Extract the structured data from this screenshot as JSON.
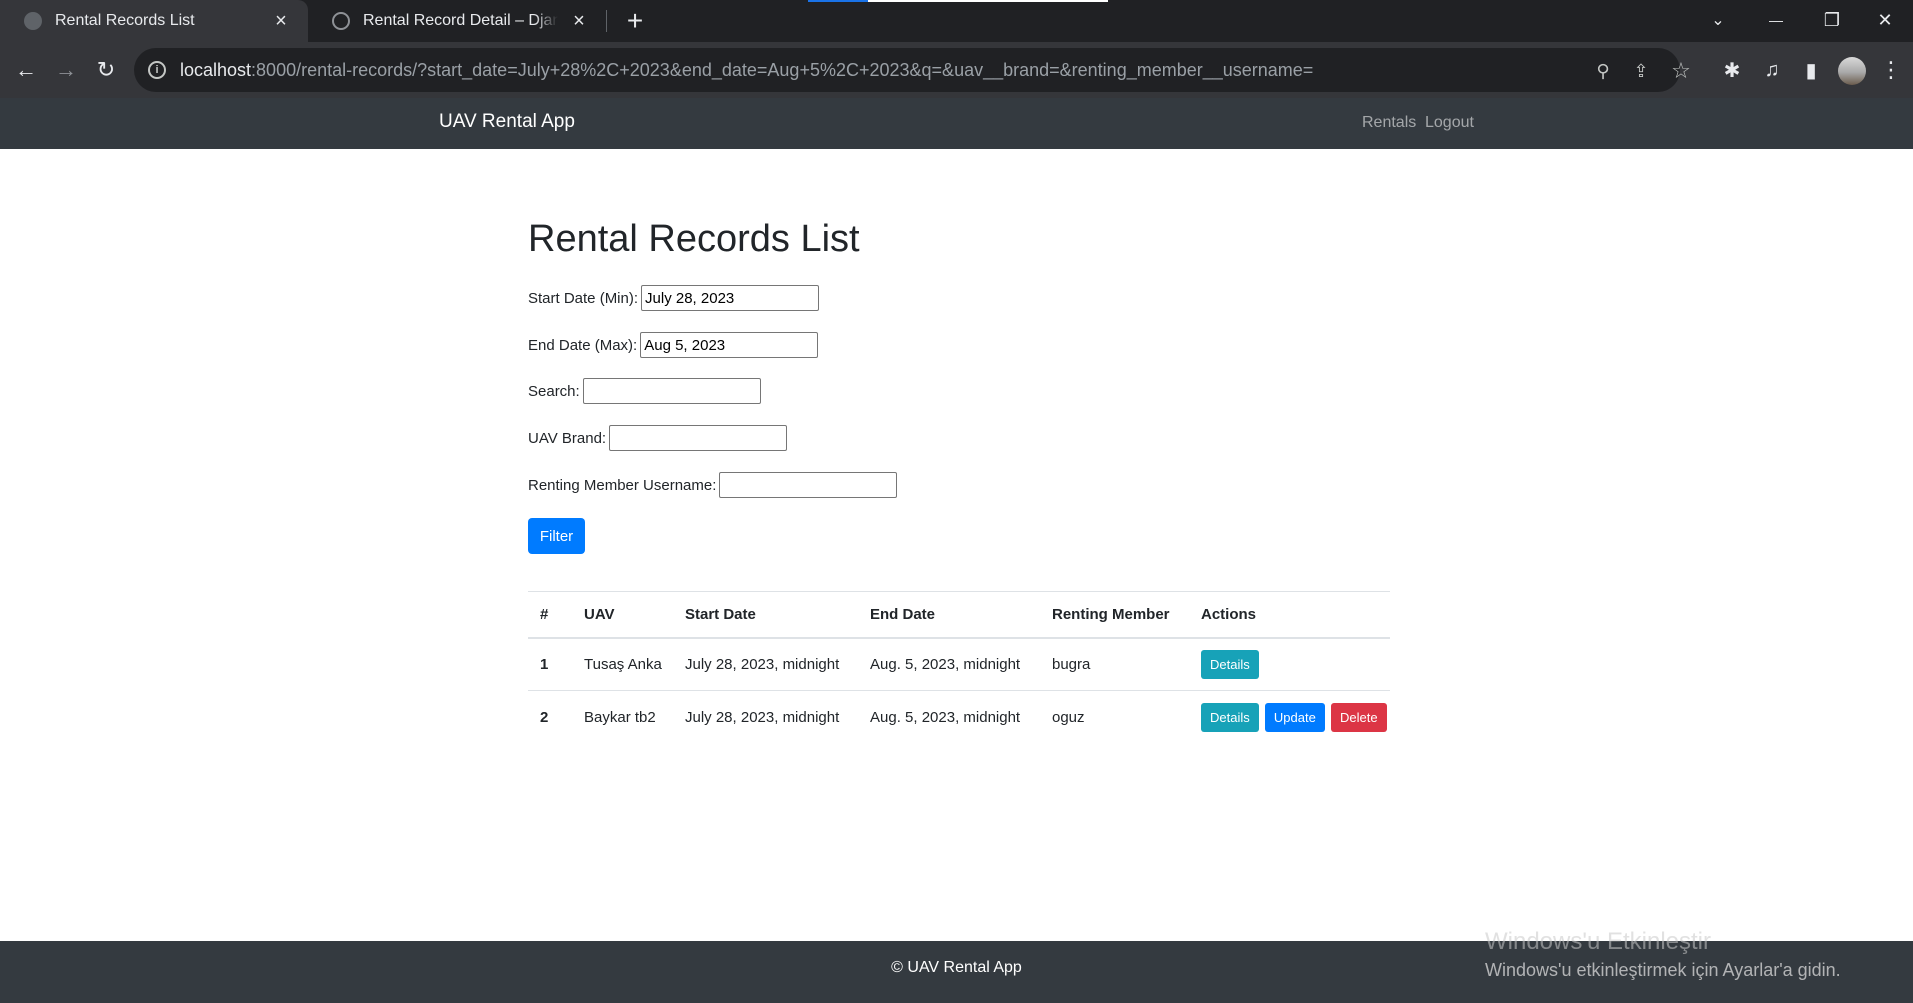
{
  "browser": {
    "tabs": [
      {
        "title": "Rental Records List",
        "active": true
      },
      {
        "title": "Rental Record Detail – Django REST framework",
        "active": false
      }
    ],
    "url_host": "localhost",
    "url_rest": ":8000/rental-records/?start_date=July+28%2C+2023&end_date=Aug+5%2C+2023&q=&uav__brand=&renting_member__username=",
    "icons": {
      "tab_close": "×",
      "new_tab": "+",
      "minimize": "—",
      "restore": "❐",
      "close": "✕",
      "tab_search": "⌄",
      "back": "←",
      "forward": "→",
      "reload": "↻",
      "zoom": "⚲",
      "share": "⇪",
      "star": "☆",
      "extensions": "✱",
      "media": "♫",
      "sidepanel": "▮",
      "menu": "⋮",
      "info": "i"
    }
  },
  "navbar": {
    "brand": "UAV Rental App",
    "links": [
      "Rentals",
      "Logout"
    ]
  },
  "page": {
    "title": "Rental Records List",
    "form": {
      "start_date_label": "Start Date (Min):",
      "start_date_value": "July 28, 2023",
      "end_date_label": "End Date (Max):",
      "end_date_value": "Aug 5, 2023",
      "search_label": "Search:",
      "search_value": "",
      "brand_label": "UAV Brand:",
      "brand_value": "",
      "username_label": "Renting Member Username:",
      "username_value": "",
      "filter_button": "Filter"
    },
    "table": {
      "headers": [
        "#",
        "UAV",
        "Start Date",
        "End Date",
        "Renting Member",
        "Actions"
      ],
      "rows": [
        {
          "num": "1",
          "uav": "Tusaş Anka",
          "start": "July 28, 2023, midnight",
          "end": "Aug. 5, 2023, midnight",
          "member": "bugra",
          "actions": [
            "Details"
          ]
        },
        {
          "num": "2",
          "uav": "Baykar tb2",
          "start": "July 28, 2023, midnight",
          "end": "Aug. 5, 2023, midnight",
          "member": "oguz",
          "actions": [
            "Details",
            "Update",
            "Delete"
          ]
        }
      ]
    }
  },
  "footer": {
    "text": "© UAV Rental App"
  },
  "watermark": {
    "title": "Windows'u Etkinleştir",
    "subtitle": "Windows'u etkinleştirmek için Ayarlar'a gidin."
  },
  "colors": {
    "navbar_bg": "#343a40",
    "primary": "#007bff",
    "info": "#17a2b8",
    "danger": "#dc3545",
    "chrome_dark": "#202124",
    "chrome_mid": "#35363a"
  }
}
